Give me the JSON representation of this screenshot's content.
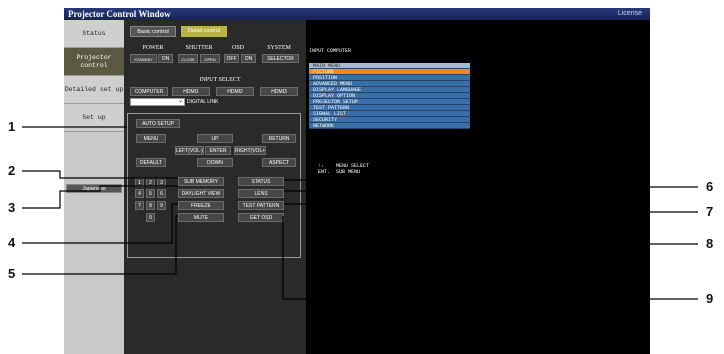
{
  "window": {
    "title": "Projector Control Window",
    "license": "License"
  },
  "sidebar": {
    "items": [
      "Status",
      "Projector control",
      "Detailed set up",
      "Set up"
    ],
    "language": "Japanese"
  },
  "tabs": {
    "basic": "Basic control",
    "detail": "Detail control"
  },
  "groups": {
    "power": "POWER",
    "shutter": "SHUTTER",
    "osd": "OSD",
    "system": "SYSTEM",
    "input_select": "INPUT SELECT"
  },
  "power": {
    "standby": "STANDBY",
    "on": "ON"
  },
  "shutter": {
    "close": "CLOSE",
    "open": "OPEN"
  },
  "osd": {
    "off": "OFF",
    "on": "ON"
  },
  "system": {
    "selector": "SELECTOR"
  },
  "inputs": {
    "computer": "COMPUTER",
    "hdmi1": "HDMI1",
    "hdmi2": "HDMI2",
    "hdmi3": "HDMI3",
    "digital_link": "DIGITAL LINK"
  },
  "nav": {
    "auto_setup": "AUTO SETUP",
    "menu": "MENU",
    "up": "UP",
    "return": "RETURN",
    "left": "LEFT(VOL-)",
    "enter": "ENTER",
    "right": "RIGHT(VOL+)",
    "default": "DEFAULT",
    "down": "DOWN",
    "aspect": "ASPECT"
  },
  "keypad": [
    "1",
    "2",
    "3",
    "4",
    "5",
    "6",
    "7",
    "8",
    "9",
    "0"
  ],
  "functions": {
    "sub_memory": "SUB MEMORY",
    "status": "STATUS",
    "daylight_view": "DAYLIGHT VIEW",
    "lens": "LENS",
    "freeze": "FREEZE",
    "test_pattern": "TEST PATTERN",
    "mute": "MUTE",
    "get_osd": "GET OSD"
  },
  "screen": {
    "input": "INPUT COMPUTER",
    "menu_header": "MAIN MENU",
    "menu_items": [
      "PICTURE",
      "POSITION",
      "ADVANCED MENU",
      "DISPLAY LANGUAGE",
      "DISPLAY OPTION",
      "PROJECTOR SETUP",
      "TEST PATTERN",
      "SIGNAL LIST",
      "SECURITY",
      "NETWORK"
    ],
    "selected_index": 0,
    "hint1": "↑↓    MENU SELECT",
    "hint2": "ENT.  SUB MENU"
  },
  "callouts": [
    "1",
    "2",
    "3",
    "4",
    "5",
    "6",
    "7",
    "8",
    "9"
  ]
}
